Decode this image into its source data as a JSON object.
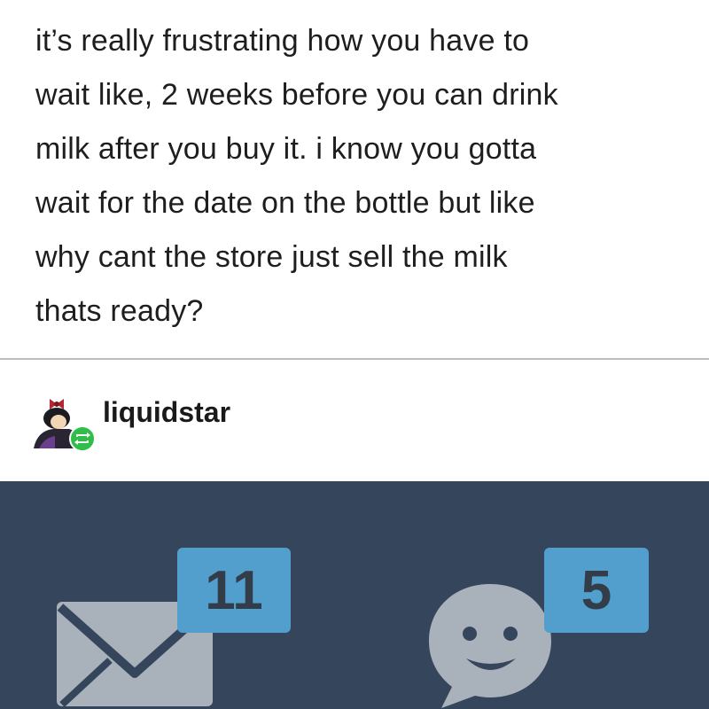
{
  "post": {
    "lines": [
      "it’s really frustrating how you have to",
      "wait like, 2 weeks before you can drink",
      "milk after you buy it. i know you gotta",
      "wait for the date on the bottle but like",
      "why cant the store just sell the milk",
      "thats ready?"
    ]
  },
  "reblog": {
    "username": "liquidstar",
    "avatar_icon": "avatar-icon",
    "reblog_icon": "reblog-icon"
  },
  "dashboard": {
    "mail": {
      "icon": "mail-icon",
      "count": "11"
    },
    "chat": {
      "icon": "chat-bubble-icon",
      "count": "5"
    }
  },
  "colors": {
    "dashboard_background": "#35465c",
    "badge": "#529ecc",
    "badge_text": "#333d4a",
    "icon": "#a9b1bb",
    "reblog_green": "#2fbe4a"
  }
}
